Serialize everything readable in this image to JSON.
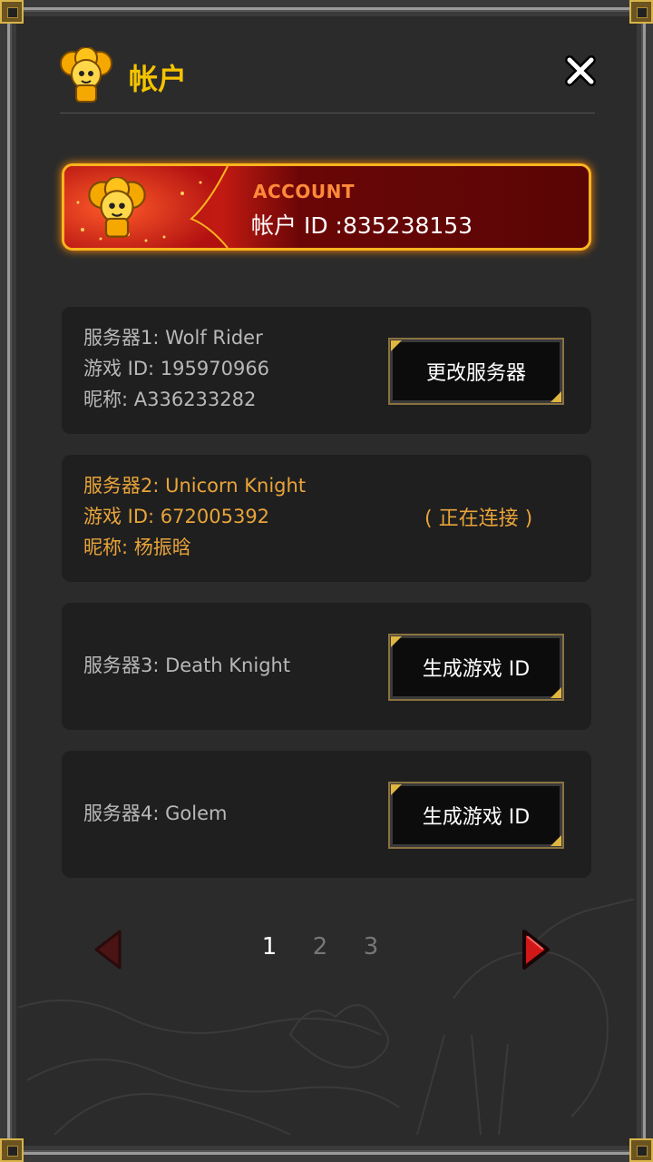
{
  "header": {
    "title": "帐户",
    "close_icon": "close-icon"
  },
  "account": {
    "label": "ACCOUNT",
    "id_text": "帐户 ID :835238153"
  },
  "servers": [
    {
      "server_line": "服务器1: Wolf Rider",
      "game_id_line": "游戏 ID: 195970966",
      "nickname_line": "昵称: A336233282",
      "button_label": "更改服务器"
    },
    {
      "server_line": "服务器2: Unicorn Knight",
      "game_id_line": "游戏 ID: 672005392",
      "nickname_line": "昵称: 杨振晗",
      "status": "( 正在连接 )"
    },
    {
      "server_line": "服务器3: Death Knight",
      "button_label": "生成游戏 ID"
    },
    {
      "server_line": "服务器4: Golem",
      "button_label": "生成游戏 ID"
    }
  ],
  "pager": {
    "pages": [
      "1",
      "2",
      "3"
    ],
    "current": "1"
  },
  "colors": {
    "title": "#f5c400",
    "active_text": "#e8a43a",
    "banner_border": "#ffb41e"
  }
}
